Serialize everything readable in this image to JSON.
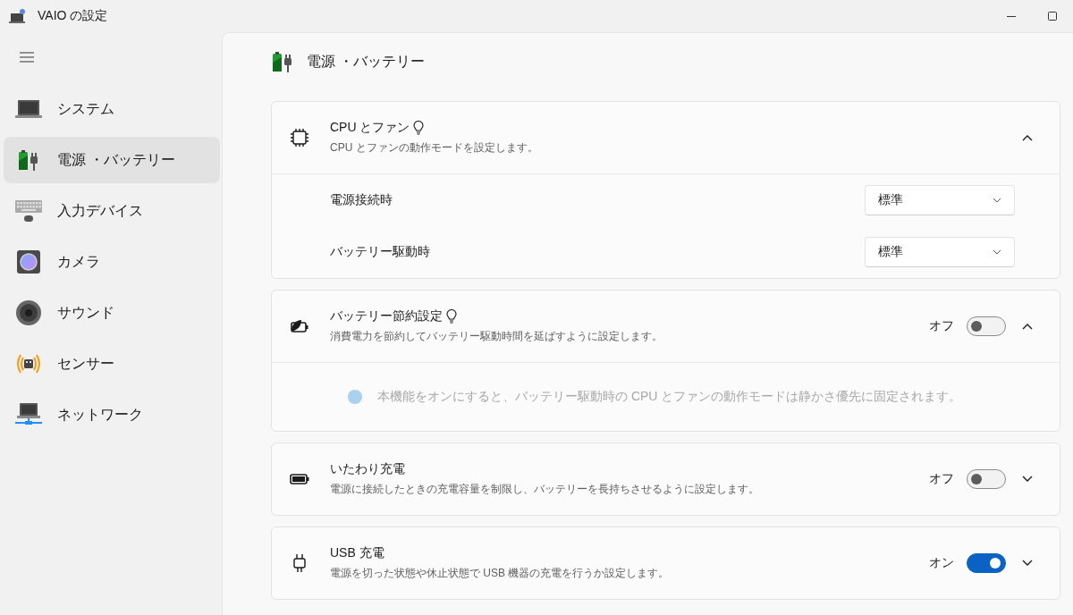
{
  "window": {
    "title": "VAIO の設定"
  },
  "sidebar": {
    "items": [
      {
        "label": "システム",
        "selected": false
      },
      {
        "label": "電源 ・バッテリー",
        "selected": true
      },
      {
        "label": "入力デバイス",
        "selected": false
      },
      {
        "label": "カメラ",
        "selected": false
      },
      {
        "label": "サウンド",
        "selected": false
      },
      {
        "label": "センサー",
        "selected": false
      },
      {
        "label": "ネットワーク",
        "selected": false
      }
    ]
  },
  "page": {
    "title": "電源 ・バッテリー"
  },
  "sections": [
    {
      "title": "CPU とファン",
      "tip": true,
      "description": "CPU とファンの動作モードを設定します。",
      "expanded": true,
      "settings": [
        {
          "label": "電源接続時",
          "value": "標準"
        },
        {
          "label": "バッテリー駆動時",
          "value": "標準"
        }
      ]
    },
    {
      "title": "バッテリー節約設定",
      "tip": true,
      "description": "消費電力を節約してバッテリー駆動時間を延ばすように設定します。",
      "expanded": true,
      "toggle": {
        "label": "オフ",
        "on": false
      },
      "info": {
        "text": "本機能をオンにすると、バッテリー駆動時の CPU とファンの動作モードは静かさ優先に固定されます。",
        "disabled": true
      }
    },
    {
      "title": "いたわり充電",
      "tip": false,
      "description": "電源に接続したときの充電容量を制限し、バッテリーを長持ちさせるように設定します。",
      "expanded": false,
      "toggle": {
        "label": "オフ",
        "on": false
      }
    },
    {
      "title": "USB 充電",
      "tip": false,
      "description": "電源を切った状態や休止状態で USB 機器の充電を行うか設定します。",
      "expanded": false,
      "toggle": {
        "label": "オン",
        "on": true
      }
    }
  ]
}
